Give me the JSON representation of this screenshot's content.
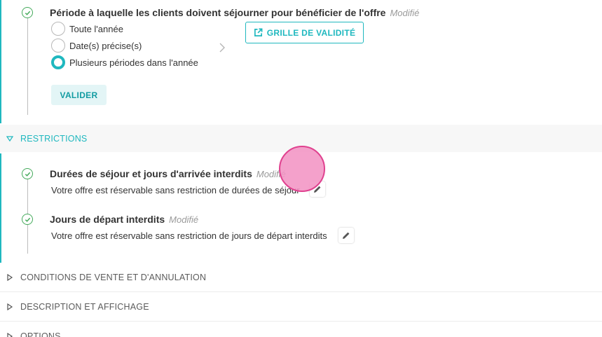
{
  "period": {
    "title": "Période à laquelle les clients doivent séjourner pour bénéficier de l'offre",
    "modified": "Modifié",
    "options": [
      {
        "label": "Toute l'année",
        "selected": false
      },
      {
        "label": "Date(s) précise(s)",
        "selected": false
      },
      {
        "label": "Plusieurs périodes dans l'année",
        "selected": true
      }
    ],
    "grille_label": "GRILLE DE VALIDITÉ",
    "valider_label": "VALIDER"
  },
  "restrictions": {
    "header": "RESTRICTIONS",
    "items": [
      {
        "title": "Durées de séjour et jours d'arrivée interdits",
        "modified": "Modifié",
        "description": "Votre offre est réservable sans restriction de durées de séjour"
      },
      {
        "title": "Jours de départ interdits",
        "modified": "Modifié",
        "description": "Votre offre est réservable sans restriction de jours de départ interdits"
      }
    ]
  },
  "sections": [
    {
      "label": "CONDITIONS DE VENTE ET D'ANNULATION"
    },
    {
      "label": "DESCRIPTION ET AFFICHAGE"
    },
    {
      "label": "OPTIONS"
    }
  ],
  "colors": {
    "accent": "#1fb8bf",
    "success": "#43a95a",
    "touch": "#f394c4"
  }
}
